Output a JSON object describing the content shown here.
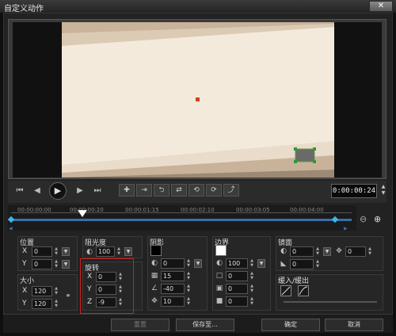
{
  "window": {
    "title": "自定义动作",
    "close_glyph": "✕"
  },
  "playback": {
    "timecode": "0:00:00:24",
    "icons": [
      "home-icon",
      "prev-frame-icon",
      "play-icon",
      "next-frame-icon",
      "end-icon"
    ],
    "glyphs": {
      "home": "⏮",
      "prev": "◀",
      "play": "▶",
      "next": "▶",
      "end": "⏭",
      "up": "▲",
      "down": "▼"
    }
  },
  "keyframe_tools": [
    "✚",
    "⇥",
    "⮌",
    "⇄",
    "⟲",
    "⟳",
    "⤴"
  ],
  "timeline": {
    "labels": [
      "00:00:00:00",
      "00:00:00:20",
      "00:00:01:15",
      "00:00:02:10",
      "00:00:03:05",
      "00:00:04:00"
    ],
    "zoom_out": "⊖",
    "zoom_in": "⊕",
    "playhead_frac": 0.21
  },
  "position": {
    "label": "位置",
    "x_label": "X",
    "x": "0",
    "y_label": "Y",
    "y": "0"
  },
  "size": {
    "label": "大小",
    "x_label": "X",
    "x": "120",
    "y_label": "Y",
    "y": "120",
    "link_glyph": "⚭"
  },
  "opacity": {
    "label": "阻光度",
    "value": "100"
  },
  "rotation": {
    "label": "旋转",
    "x_label": "X",
    "x": "0",
    "y_label": "Y",
    "y": "0",
    "z_label": "Z",
    "z": "-9"
  },
  "shadow": {
    "label": "阴影",
    "opacity": "0",
    "blur": "15",
    "angle": "-40",
    "distance": "10",
    "color": "#000000"
  },
  "border": {
    "label": "边界",
    "opacity": "100",
    "v1": "0",
    "v2": "0",
    "v3": "0",
    "color": "#ffffff"
  },
  "mirror": {
    "label": "镜面",
    "v1": "0",
    "v2": "0",
    "v3": "0"
  },
  "fade": {
    "label": "缓入/缓出"
  },
  "buttons": {
    "reset": "重置",
    "save_to": "保存至...",
    "ok": "确定",
    "cancel": "取消"
  },
  "colors": {
    "accent": "#3b6ea8",
    "highlight_box": "#d21f1f",
    "canvas_bg": "#f4eadc"
  }
}
